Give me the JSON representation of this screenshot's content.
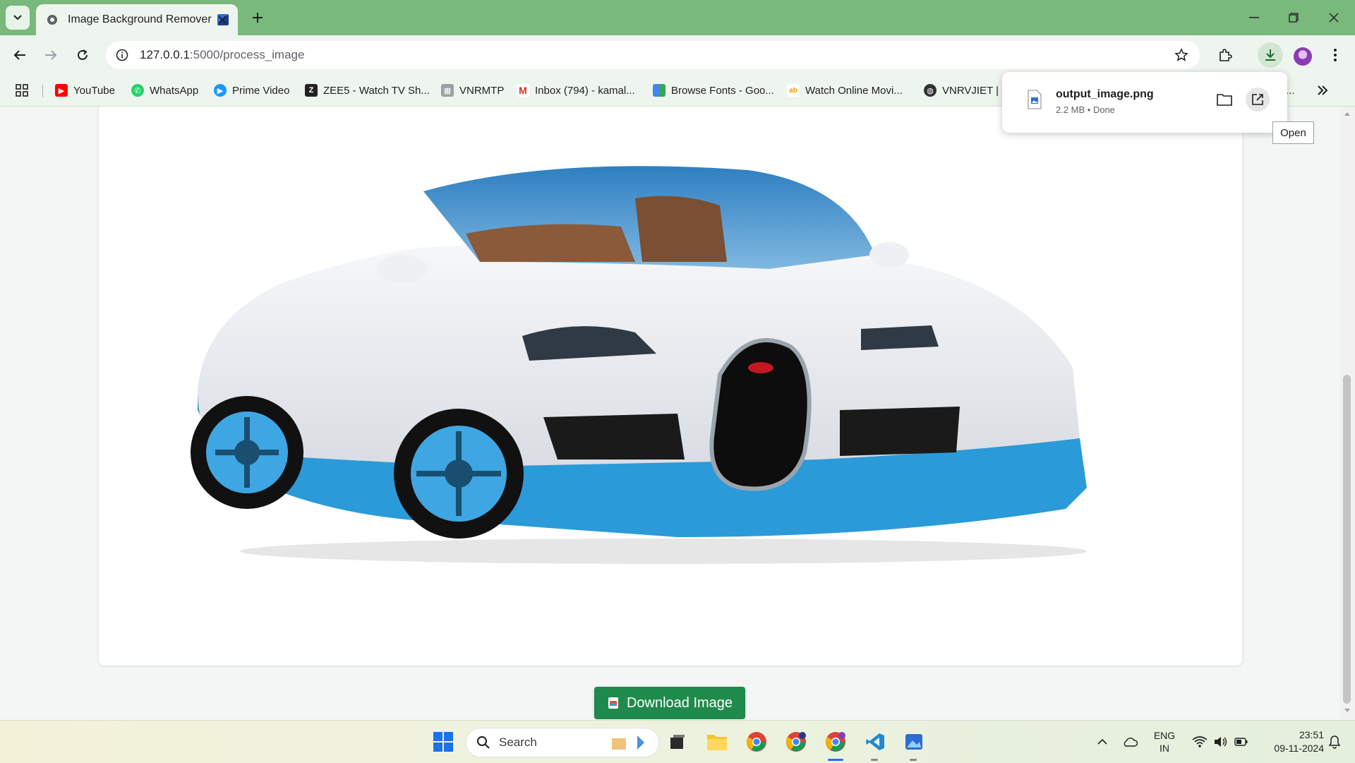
{
  "browser": {
    "tab": {
      "title": "Image Background Remover"
    },
    "address_bar": {
      "host": "127.0.0.1",
      "path": ":5000/process_image"
    },
    "bookmarks": [
      {
        "label": "YouTube",
        "icon": "youtube-icon",
        "color": "#ff0000"
      },
      {
        "label": "WhatsApp",
        "icon": "whatsapp-icon",
        "color": "#25d366"
      },
      {
        "label": "Prime Video",
        "icon": "prime-video-icon",
        "color": "#1a98ff"
      },
      {
        "label": "ZEE5 - Watch TV Sh...",
        "icon": "zee5-icon",
        "color": "#222222"
      },
      {
        "label": "VNRMTP",
        "icon": "vnrmtp-icon",
        "color": "#888888"
      },
      {
        "label": "Inbox (794) - kamal...",
        "icon": "gmail-icon",
        "color": "#d93025"
      },
      {
        "label": "Browse Fonts - Goo...",
        "icon": "google-fonts-icon",
        "color": "#4285f4"
      },
      {
        "label": "Watch Online Movi...",
        "icon": "movies-icon",
        "color": "#f29900"
      },
      {
        "label": "VNRVJIET | H",
        "icon": "globe-icon",
        "color": "#333333"
      }
    ],
    "bookmarks_overflow": "..."
  },
  "download_bubble": {
    "file_name": "output_image.png",
    "meta": "2.2 MB • Done",
    "tooltip": "Open"
  },
  "page": {
    "download_button_label": "Download Image"
  },
  "taskbar": {
    "search_placeholder": "Search",
    "language_top": "ENG",
    "language_bottom": "IN",
    "time": "23:51",
    "date": "09-11-2024"
  },
  "colors": {
    "tabstrip": "#79b97b",
    "toolbar": "#eef5ee",
    "download_button": "#1e8a4c"
  }
}
